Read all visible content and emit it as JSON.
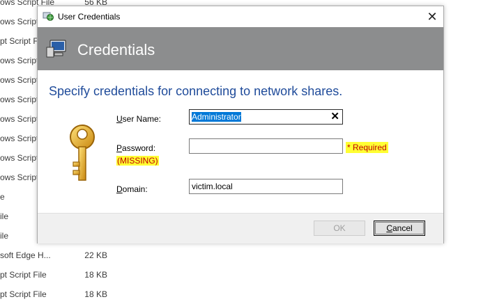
{
  "background_list": {
    "rows": [
      {
        "name": "ows Script File",
        "size": "56 KB"
      },
      {
        "name": "ows Script File",
        "size": ""
      },
      {
        "name": "pt Script File",
        "size": ""
      },
      {
        "name": "ows Script File",
        "size": ""
      },
      {
        "name": "ows Script File",
        "size": ""
      },
      {
        "name": "ows Script File",
        "size": ""
      },
      {
        "name": "ows Script File",
        "size": ""
      },
      {
        "name": "ows Script File",
        "size": ""
      },
      {
        "name": "ows Script File",
        "size": ""
      },
      {
        "name": "ows Script File",
        "size": ""
      },
      {
        "name": "e",
        "size": ""
      },
      {
        "name": "ile",
        "size": ""
      },
      {
        "name": "ile",
        "size": ""
      },
      {
        "name": "soft Edge H...",
        "size": "22 KB"
      },
      {
        "name": "pt Script File",
        "size": "18 KB"
      },
      {
        "name": "pt Script File",
        "size": "18 KB"
      }
    ]
  },
  "dialog": {
    "window_title": "User Credentials",
    "close_glyph": "✕",
    "banner_title": "Credentials",
    "instruction": "Specify credentials for connecting to network shares.",
    "fields": {
      "username_label": "User Name:",
      "username_value": "Administrator",
      "clear_glyph": "🗙",
      "password_label": "Password:",
      "password_value": "",
      "password_required": "* Required",
      "password_missing": "(MISSING)",
      "domain_label": "Domain:",
      "domain_value": "victim.local"
    },
    "buttons": {
      "ok_label": "OK",
      "cancel_label": "Cancel"
    }
  },
  "colors": {
    "banner_bg": "#8c8d8e",
    "instruction_text": "#1f4b9a",
    "highlight_yellow": "#ffff33",
    "warning_red": "#c00000",
    "selection_blue": "#0078d7"
  }
}
